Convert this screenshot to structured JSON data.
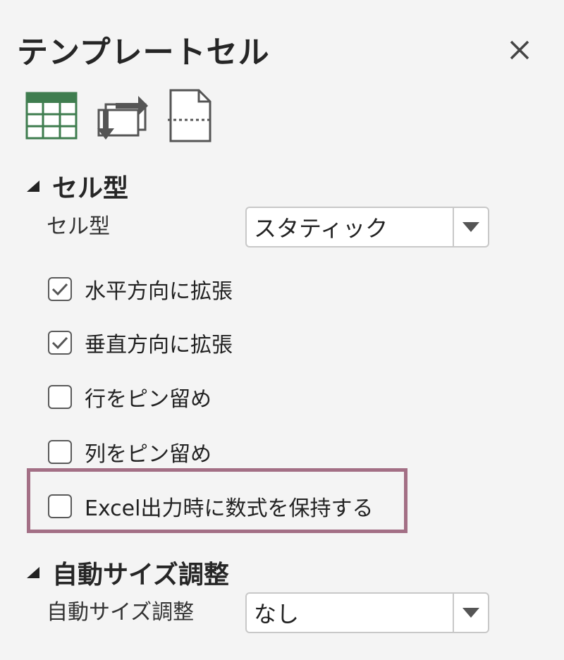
{
  "panel": {
    "title": "テンプレートセル"
  },
  "toolbar": {
    "icons": [
      "table-icon",
      "swap-icon",
      "page-break-icon"
    ]
  },
  "cell_type_section": {
    "heading": "セル型",
    "cell_type_label": "セル型",
    "cell_type_value": "スタティック",
    "checkboxes": [
      {
        "label": "水平方向に拡張",
        "checked": true
      },
      {
        "label": "垂直方向に拡張",
        "checked": true
      },
      {
        "label": "行をピン留め",
        "checked": false
      },
      {
        "label": "列をピン留め",
        "checked": false
      },
      {
        "label": "Excel出力時に数式を保持する",
        "checked": false
      }
    ]
  },
  "auto_size_section": {
    "heading": "自動サイズ調整",
    "auto_size_label": "自動サイズ調整",
    "auto_size_value": "なし"
  },
  "colors": {
    "highlight_border": "#a36f85",
    "table_icon_green": "#3f7d4f"
  }
}
